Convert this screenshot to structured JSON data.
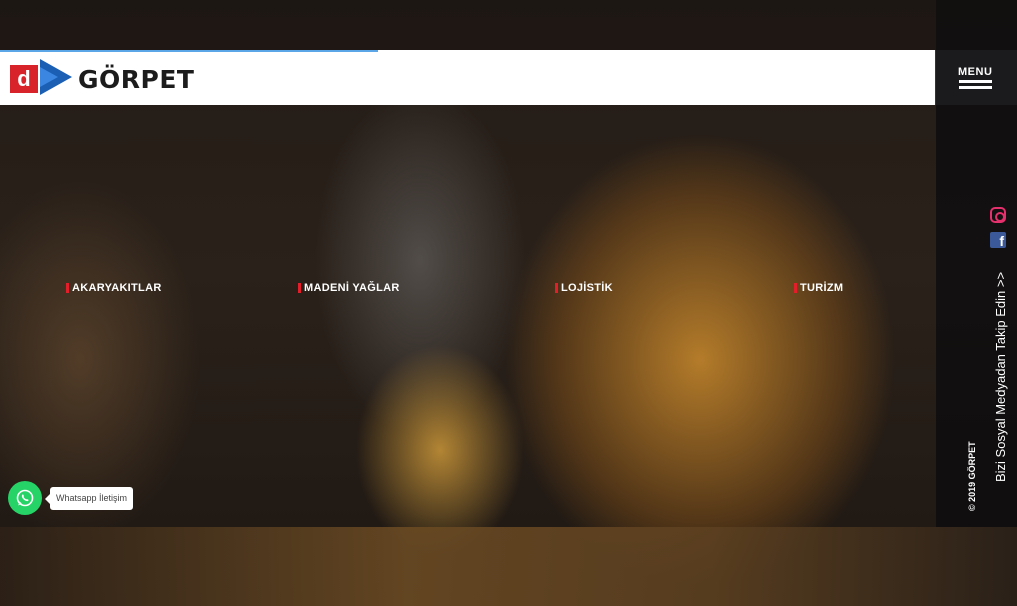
{
  "brand": {
    "logo_mark": "d",
    "name": "GÖRPET"
  },
  "menu": {
    "label": "MENU"
  },
  "categories": [
    {
      "label": "AKARYAKITLAR"
    },
    {
      "label": "MADENİ YAĞLAR"
    },
    {
      "label": "LOJİSTİK"
    },
    {
      "label": "TURİZM"
    }
  ],
  "social": {
    "icons": [
      "instagram-icon",
      "facebook-icon"
    ],
    "follow_text": "Bizi Sosyal Medyadan Takip Edin >>",
    "copyright": "© 2019 GÖRPET"
  },
  "whatsapp": {
    "label": "Whatsapp İletişim"
  },
  "colors": {
    "accent_red": "#e21e2a",
    "brand_blue": "#1a5fb4",
    "whatsapp_green": "#25d366",
    "progress_blue": "#5aa6e6"
  }
}
